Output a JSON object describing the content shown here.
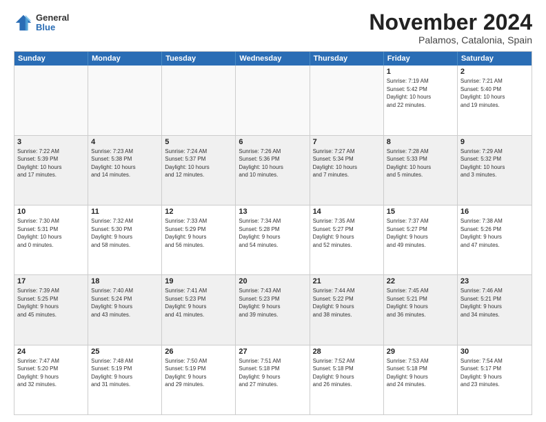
{
  "logo": {
    "general": "General",
    "blue": "Blue"
  },
  "title": {
    "month": "November 2024",
    "location": "Palamos, Catalonia, Spain"
  },
  "headers": [
    "Sunday",
    "Monday",
    "Tuesday",
    "Wednesday",
    "Thursday",
    "Friday",
    "Saturday"
  ],
  "rows": [
    [
      {
        "day": "",
        "info": "",
        "empty": true
      },
      {
        "day": "",
        "info": "",
        "empty": true
      },
      {
        "day": "",
        "info": "",
        "empty": true
      },
      {
        "day": "",
        "info": "",
        "empty": true
      },
      {
        "day": "",
        "info": "",
        "empty": true
      },
      {
        "day": "1",
        "info": "Sunrise: 7:19 AM\nSunset: 5:42 PM\nDaylight: 10 hours\nand 22 minutes."
      },
      {
        "day": "2",
        "info": "Sunrise: 7:21 AM\nSunset: 5:40 PM\nDaylight: 10 hours\nand 19 minutes."
      }
    ],
    [
      {
        "day": "3",
        "info": "Sunrise: 7:22 AM\nSunset: 5:39 PM\nDaylight: 10 hours\nand 17 minutes."
      },
      {
        "day": "4",
        "info": "Sunrise: 7:23 AM\nSunset: 5:38 PM\nDaylight: 10 hours\nand 14 minutes."
      },
      {
        "day": "5",
        "info": "Sunrise: 7:24 AM\nSunset: 5:37 PM\nDaylight: 10 hours\nand 12 minutes."
      },
      {
        "day": "6",
        "info": "Sunrise: 7:26 AM\nSunset: 5:36 PM\nDaylight: 10 hours\nand 10 minutes."
      },
      {
        "day": "7",
        "info": "Sunrise: 7:27 AM\nSunset: 5:34 PM\nDaylight: 10 hours\nand 7 minutes."
      },
      {
        "day": "8",
        "info": "Sunrise: 7:28 AM\nSunset: 5:33 PM\nDaylight: 10 hours\nand 5 minutes."
      },
      {
        "day": "9",
        "info": "Sunrise: 7:29 AM\nSunset: 5:32 PM\nDaylight: 10 hours\nand 3 minutes."
      }
    ],
    [
      {
        "day": "10",
        "info": "Sunrise: 7:30 AM\nSunset: 5:31 PM\nDaylight: 10 hours\nand 0 minutes."
      },
      {
        "day": "11",
        "info": "Sunrise: 7:32 AM\nSunset: 5:30 PM\nDaylight: 9 hours\nand 58 minutes."
      },
      {
        "day": "12",
        "info": "Sunrise: 7:33 AM\nSunset: 5:29 PM\nDaylight: 9 hours\nand 56 minutes."
      },
      {
        "day": "13",
        "info": "Sunrise: 7:34 AM\nSunset: 5:28 PM\nDaylight: 9 hours\nand 54 minutes."
      },
      {
        "day": "14",
        "info": "Sunrise: 7:35 AM\nSunset: 5:27 PM\nDaylight: 9 hours\nand 52 minutes."
      },
      {
        "day": "15",
        "info": "Sunrise: 7:37 AM\nSunset: 5:27 PM\nDaylight: 9 hours\nand 49 minutes."
      },
      {
        "day": "16",
        "info": "Sunrise: 7:38 AM\nSunset: 5:26 PM\nDaylight: 9 hours\nand 47 minutes."
      }
    ],
    [
      {
        "day": "17",
        "info": "Sunrise: 7:39 AM\nSunset: 5:25 PM\nDaylight: 9 hours\nand 45 minutes."
      },
      {
        "day": "18",
        "info": "Sunrise: 7:40 AM\nSunset: 5:24 PM\nDaylight: 9 hours\nand 43 minutes."
      },
      {
        "day": "19",
        "info": "Sunrise: 7:41 AM\nSunset: 5:23 PM\nDaylight: 9 hours\nand 41 minutes."
      },
      {
        "day": "20",
        "info": "Sunrise: 7:43 AM\nSunset: 5:23 PM\nDaylight: 9 hours\nand 39 minutes."
      },
      {
        "day": "21",
        "info": "Sunrise: 7:44 AM\nSunset: 5:22 PM\nDaylight: 9 hours\nand 38 minutes."
      },
      {
        "day": "22",
        "info": "Sunrise: 7:45 AM\nSunset: 5:21 PM\nDaylight: 9 hours\nand 36 minutes."
      },
      {
        "day": "23",
        "info": "Sunrise: 7:46 AM\nSunset: 5:21 PM\nDaylight: 9 hours\nand 34 minutes."
      }
    ],
    [
      {
        "day": "24",
        "info": "Sunrise: 7:47 AM\nSunset: 5:20 PM\nDaylight: 9 hours\nand 32 minutes."
      },
      {
        "day": "25",
        "info": "Sunrise: 7:48 AM\nSunset: 5:19 PM\nDaylight: 9 hours\nand 31 minutes."
      },
      {
        "day": "26",
        "info": "Sunrise: 7:50 AM\nSunset: 5:19 PM\nDaylight: 9 hours\nand 29 minutes."
      },
      {
        "day": "27",
        "info": "Sunrise: 7:51 AM\nSunset: 5:18 PM\nDaylight: 9 hours\nand 27 minutes."
      },
      {
        "day": "28",
        "info": "Sunrise: 7:52 AM\nSunset: 5:18 PM\nDaylight: 9 hours\nand 26 minutes."
      },
      {
        "day": "29",
        "info": "Sunrise: 7:53 AM\nSunset: 5:18 PM\nDaylight: 9 hours\nand 24 minutes."
      },
      {
        "day": "30",
        "info": "Sunrise: 7:54 AM\nSunset: 5:17 PM\nDaylight: 9 hours\nand 23 minutes."
      }
    ]
  ]
}
